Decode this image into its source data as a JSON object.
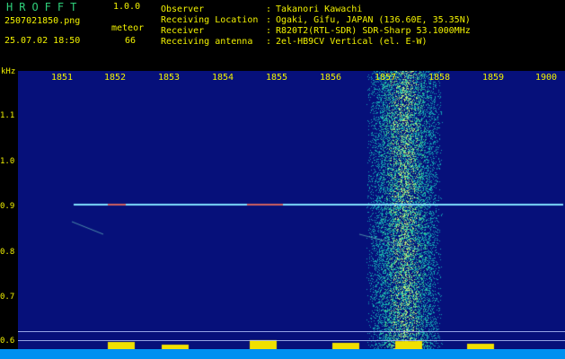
{
  "header": {
    "app_title": "HROFFT",
    "app_version": "1.0.0",
    "filename": "2507021850.png",
    "datetime": "25.07.02 18:50",
    "meteor_label": "meteor",
    "meteor_count": "66",
    "info": [
      {
        "key": "Observer",
        "value": "Takanori Kawachi"
      },
      {
        "key": "Receiving Location",
        "value": "Ogaki, Gifu, JAPAN (136.60E, 35.35N)"
      },
      {
        "key": "Receiver",
        "value": "R820T2(RTL-SDR) SDR-Sharp 53.1000MHz"
      },
      {
        "key": "Receiving antenna",
        "value": "2el-HB9CV Vertical (el. E-W)"
      }
    ],
    "separator": ":"
  },
  "axes": {
    "y_unit": "kHz",
    "y_ticks": [
      "1.1",
      "1.0",
      "0.9",
      "0.8",
      "0.7",
      "0.6"
    ],
    "x_ticks": [
      "1851",
      "1852",
      "1853",
      "1854",
      "1855",
      "1856",
      "1857",
      "1858",
      "1859",
      "1900"
    ]
  },
  "colors": {
    "background": "#06107a",
    "text_yellow": "#f2f200",
    "text_green": "#2fd07a",
    "bottom_bar": "#0090f0"
  }
}
